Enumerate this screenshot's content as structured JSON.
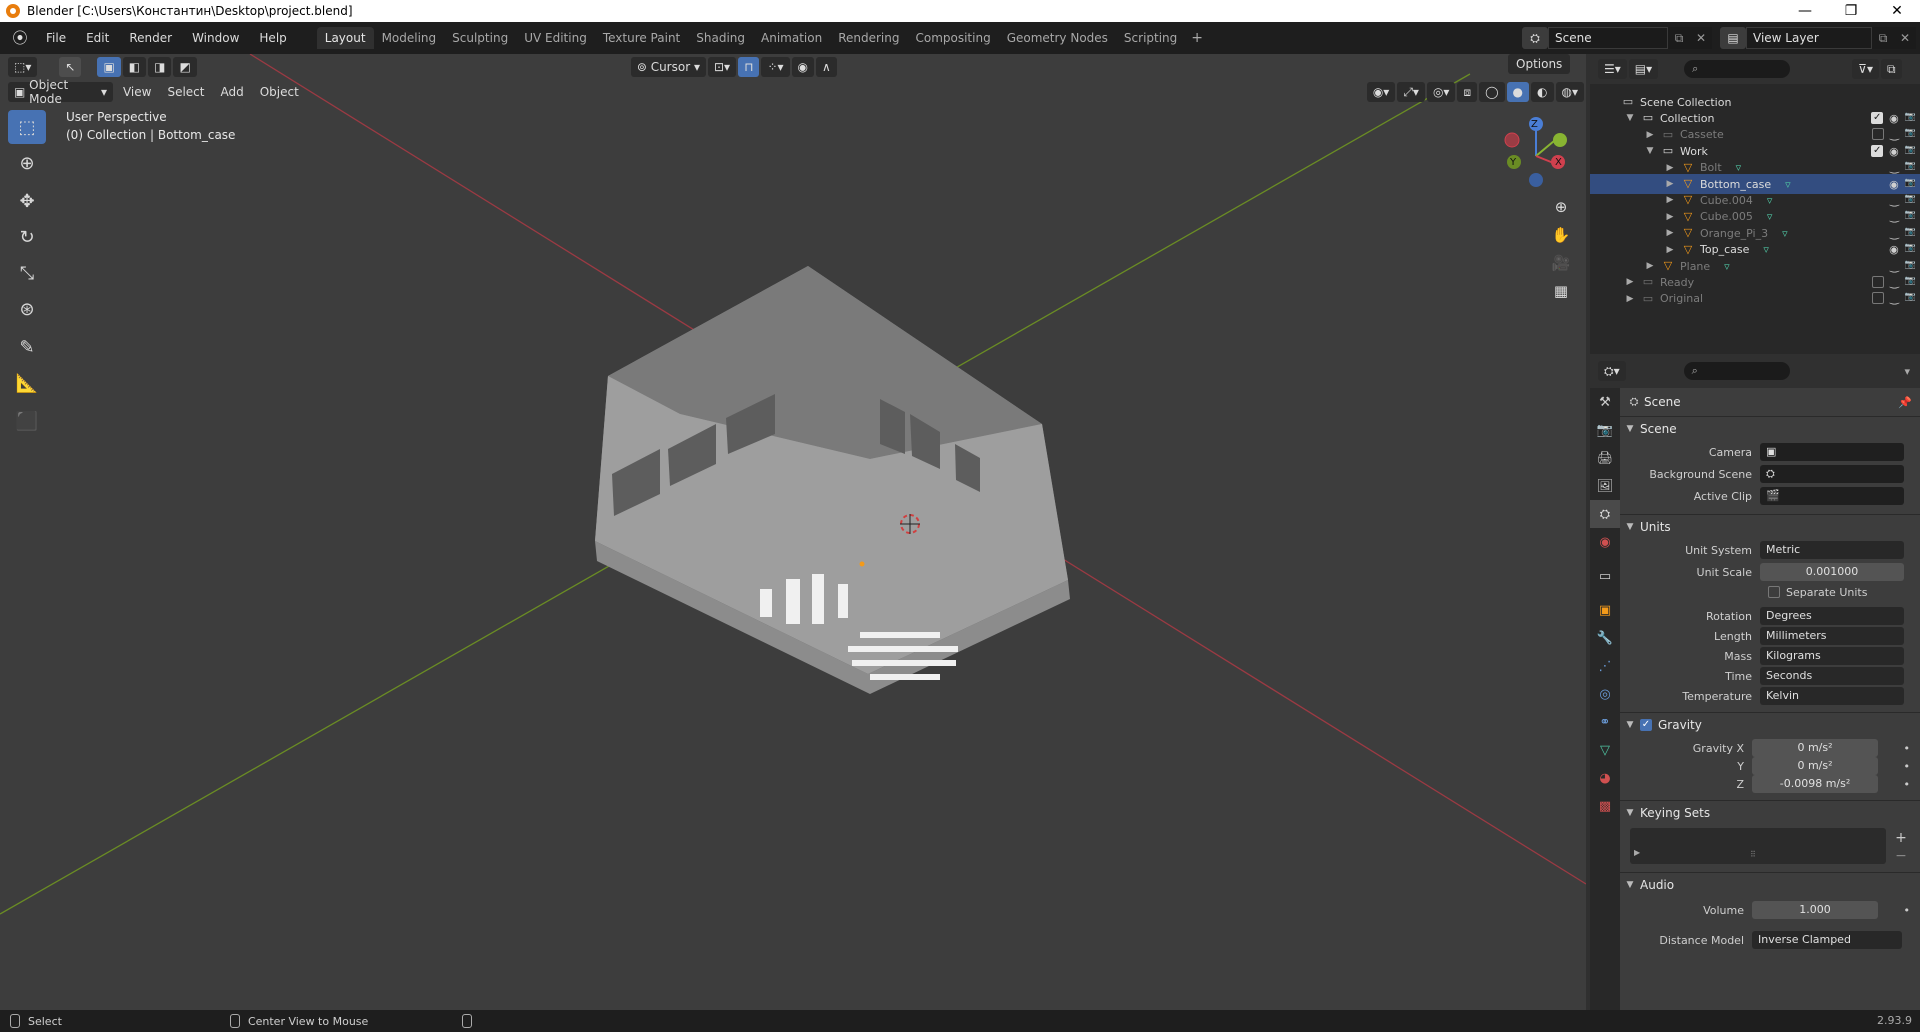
{
  "titlebar": {
    "title": "Blender [C:\\Users\\Константин\\Desktop\\project.blend]",
    "minimize": "—",
    "restore": "❐",
    "close": "✕"
  },
  "menu": [
    "File",
    "Edit",
    "Render",
    "Window",
    "Help"
  ],
  "workspaces": [
    {
      "label": "Layout",
      "active": true
    },
    {
      "label": "Modeling"
    },
    {
      "label": "Sculpting"
    },
    {
      "label": "UV Editing"
    },
    {
      "label": "Texture Paint"
    },
    {
      "label": "Shading"
    },
    {
      "label": "Animation"
    },
    {
      "label": "Rendering"
    },
    {
      "label": "Compositing"
    },
    {
      "label": "Geometry Nodes"
    },
    {
      "label": "Scripting"
    }
  ],
  "scene_selector": {
    "value": "Scene"
  },
  "view_layer_selector": {
    "value": "View Layer"
  },
  "viewport_header": {
    "mode": "Object Mode",
    "menus": [
      "View",
      "Select",
      "Add",
      "Object"
    ],
    "pivot": "Cursor",
    "options": "Options"
  },
  "viewport_overlay": {
    "line1": "User Perspective",
    "line2": "(0) Collection | Bottom_case"
  },
  "gizmo": {
    "x": "X",
    "y": "Y",
    "z": "Z"
  },
  "outliner": {
    "rows": [
      {
        "label": "Scene Collection",
        "depth": 0,
        "type": "scene"
      },
      {
        "label": "Collection",
        "depth": 1,
        "type": "collection",
        "expanded": true,
        "checked": true
      },
      {
        "label": "Cassete",
        "depth": 2,
        "type": "collection",
        "dim": true,
        "checked": false
      },
      {
        "label": "Work",
        "depth": 2,
        "type": "collection",
        "expanded": true,
        "checked": true
      },
      {
        "label": "Bolt",
        "depth": 3,
        "type": "mesh",
        "dim": true
      },
      {
        "label": "Bottom_case",
        "depth": 3,
        "type": "mesh",
        "selected": true
      },
      {
        "label": "Cube.004",
        "depth": 3,
        "type": "mesh",
        "dim": true
      },
      {
        "label": "Cube.005",
        "depth": 3,
        "type": "mesh",
        "dim": true
      },
      {
        "label": "Orange_Pi_3",
        "depth": 3,
        "type": "mesh",
        "dim": true
      },
      {
        "label": "Top_case",
        "depth": 3,
        "type": "mesh"
      },
      {
        "label": "Plane",
        "depth": 2,
        "type": "mesh",
        "dim": true
      },
      {
        "label": "Ready",
        "depth": 1,
        "type": "collection",
        "dim": true,
        "checked": false
      },
      {
        "label": "Original",
        "depth": 1,
        "type": "collection",
        "dim": true,
        "checked": false
      }
    ]
  },
  "properties": {
    "context": "Scene",
    "scene_section": "Scene",
    "camera_label": "Camera",
    "background_scene_label": "Background Scene",
    "active_clip_label": "Active Clip",
    "units_section": "Units",
    "unit_system_label": "Unit System",
    "unit_system": "Metric",
    "unit_scale_label": "Unit Scale",
    "unit_scale": "0.001000",
    "separate_units": "Separate Units",
    "rotation_label": "Rotation",
    "rotation": "Degrees",
    "length_label": "Length",
    "length": "Millimeters",
    "mass_label": "Mass",
    "mass": "Kilograms",
    "time_label": "Time",
    "time": "Seconds",
    "temperature_label": "Temperature",
    "temperature": "Kelvin",
    "gravity_section": "Gravity",
    "gravity_x_label": "Gravity X",
    "gravity_x": "0 m/s²",
    "gravity_y_label": "Y",
    "gravity_y": "0 m/s²",
    "gravity_z_label": "Z",
    "gravity_z": "-0.0098 m/s²",
    "keying_sets_section": "Keying Sets",
    "audio_section": "Audio",
    "volume_label": "Volume",
    "volume": "1.000",
    "distance_model_label": "Distance Model",
    "distance_model": "Inverse Clamped"
  },
  "statusbar": {
    "left": "Select",
    "middle": "Center View to Mouse",
    "version": "2.93.9"
  },
  "colors": {
    "accent": "#4772b3",
    "axis_x": "#9b3a43",
    "axis_y": "#6a8c24",
    "mesh": "#a0a0a0"
  }
}
